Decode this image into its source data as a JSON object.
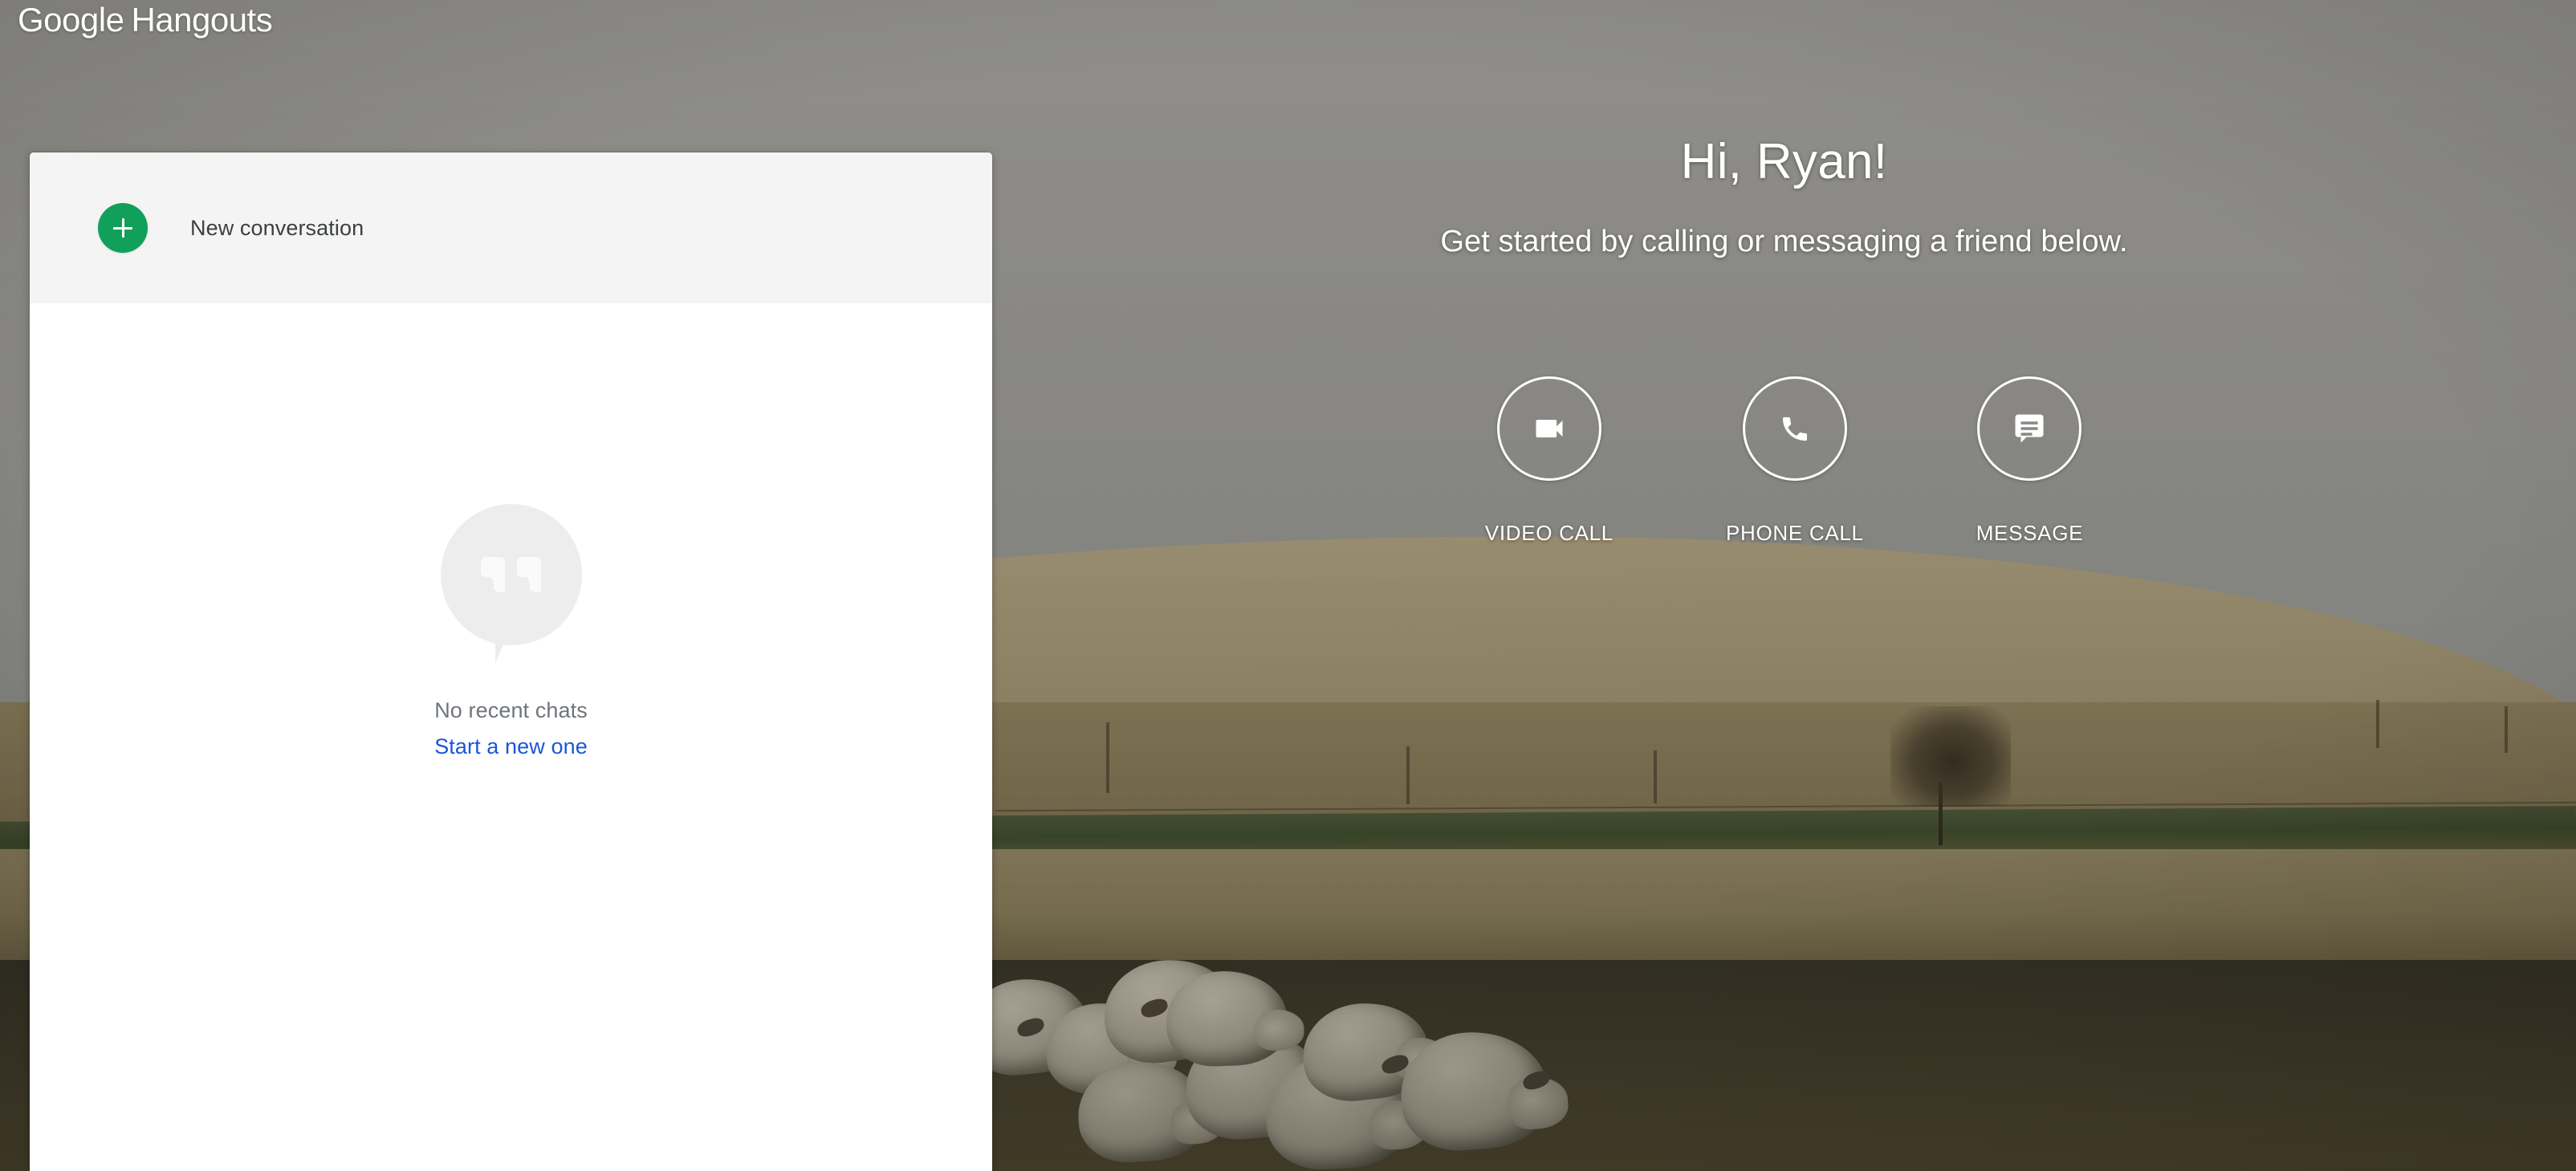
{
  "app": {
    "logo_primary": "Google",
    "logo_secondary": "Hangouts",
    "brand_green": "#10a05a",
    "link_blue": "#1a56db"
  },
  "sidebar": {
    "new_conversation": {
      "label": "New conversation",
      "icon": "plus-icon"
    },
    "empty_state": {
      "icon": "hangouts-quote-bubble-icon",
      "title": "No recent chats",
      "link": "Start a new one"
    }
  },
  "hero": {
    "greeting": "Hi, Ryan!",
    "subtitle": "Get started by calling or messaging a friend below.",
    "actions": [
      {
        "label": "VIDEO CALL",
        "icon": "video-camera-icon"
      },
      {
        "label": "PHONE CALL",
        "icon": "phone-handset-icon"
      },
      {
        "label": "MESSAGE",
        "icon": "message-bubble-icon"
      }
    ]
  },
  "background": {
    "description": "Photograph of a flock of sheep in a golden rolling pasture under an overcast gray sky with a lone bare tree",
    "sky_color": "#8a8a86",
    "hill_color": "#968a6b",
    "grass_color": "#3d4a2c",
    "field_color": "#46412e"
  }
}
